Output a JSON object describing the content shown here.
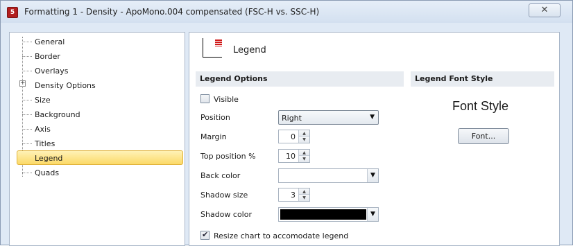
{
  "window": {
    "title": "Formatting 1 - Density - ApoMono.004 compensated (FSC-H vs. SSC-H)",
    "app_icon": "app-icon",
    "close_symbol": "✕"
  },
  "tree": {
    "items": [
      {
        "label": "General"
      },
      {
        "label": "Border"
      },
      {
        "label": "Overlays"
      },
      {
        "label": "Density Options",
        "expandable": true
      },
      {
        "label": "Size"
      },
      {
        "label": "Background"
      },
      {
        "label": "Axis"
      },
      {
        "label": "Titles"
      },
      {
        "label": "Legend",
        "selected": true
      },
      {
        "label": "Quads"
      }
    ],
    "expand_symbol": "+"
  },
  "panel": {
    "heading": "Legend",
    "legend_options": {
      "header": "Legend Options",
      "visible": {
        "label": "Visible",
        "checked": false
      },
      "position": {
        "label": "Position",
        "value": "Right"
      },
      "margin": {
        "label": "Margin",
        "value": "0"
      },
      "top_position": {
        "label": "Top position %",
        "value": "10"
      },
      "back_color": {
        "label": "Back color",
        "color": "#ffffff"
      },
      "shadow_size": {
        "label": "Shadow size",
        "value": "3"
      },
      "shadow_color": {
        "label": "Shadow color",
        "color": "#000000"
      },
      "resize": {
        "label": "Resize chart to accomodate legend",
        "checked": true
      }
    },
    "legend_font_style": {
      "header": "Legend Font Style",
      "sample": "Font Style",
      "button_label": "Font..."
    }
  },
  "colors": {
    "selected_highlight": "#fbd968",
    "legend_swatch": "#d01818"
  }
}
